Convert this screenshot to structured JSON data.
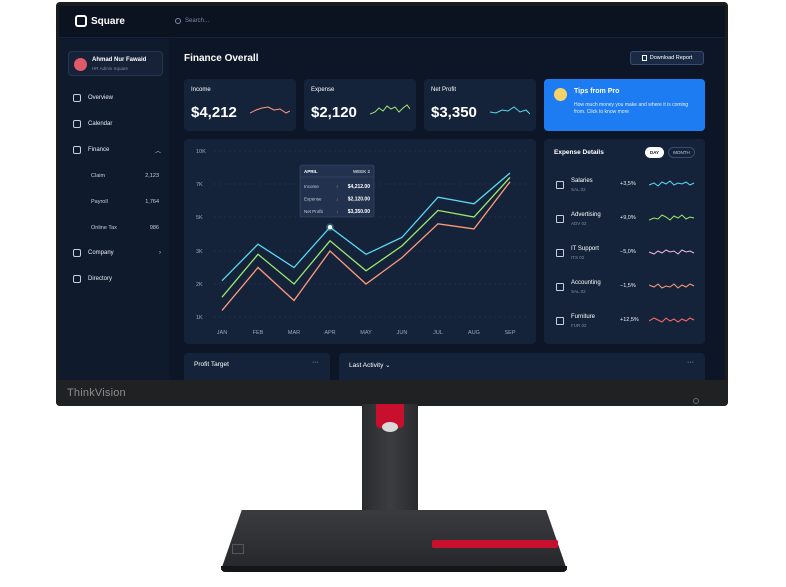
{
  "monitor": {
    "brand": "ThinkVision"
  },
  "app": {
    "name": "Square",
    "search_placeholder": "Search..."
  },
  "profile": {
    "name": "Ahmad Nur Fawaid",
    "role": "HR Admin Square"
  },
  "nav": {
    "overview": "Overview",
    "calendar": "Calendar",
    "finance": "Finance",
    "claim": {
      "label": "Claim",
      "count": "2,123"
    },
    "payroll": {
      "label": "Payroll",
      "count": "1,764"
    },
    "online_tax": {
      "label": "Online Tax",
      "count": "986"
    },
    "company": "Company",
    "directory": "Directory"
  },
  "main": {
    "title": "Finance Overall",
    "download_label": "Download Report"
  },
  "cards": [
    {
      "label": "Income",
      "value": "$4,212",
      "color": "#ff9b7a"
    },
    {
      "label": "Expense",
      "value": "$2,120",
      "color": "#9be870"
    },
    {
      "label": "Net Profit",
      "value": "$3,350",
      "color": "#5ad8f0"
    }
  ],
  "tips": {
    "title": "Tips from Pro",
    "text": "How much money you make and where it is coming from. Click to know more"
  },
  "chart_data": {
    "type": "line",
    "categories": [
      "JAN",
      "FEB",
      "MAR",
      "APR",
      "MAY",
      "JUN",
      "JUL",
      "AUG",
      "SEP"
    ],
    "y_ticks": [
      "10K",
      "7K",
      "5K",
      "3K",
      "2K",
      "1K"
    ],
    "series": [
      {
        "name": "Income",
        "color": "#5ad8f0",
        "values": [
          2100,
          3400,
          2500,
          4400,
          2900,
          3800,
          6200,
          5800,
          8000
        ]
      },
      {
        "name": "Expense",
        "color": "#9be870",
        "values": [
          1600,
          2900,
          2000,
          3600,
          2400,
          3300,
          5400,
          5000,
          7600
        ]
      },
      {
        "name": "Net Profit",
        "color": "#ff9b7a",
        "values": [
          1200,
          2500,
          1500,
          3000,
          2000,
          2800,
          4600,
          4300,
          7200
        ]
      }
    ],
    "tooltip": {
      "month": "APRIL",
      "week": "WEEK 2",
      "rows": [
        {
          "label": "Income",
          "value": "$4,212.00"
        },
        {
          "label": "Expense",
          "value": "$2,120.00"
        },
        {
          "label": "Net Profit",
          "value": "$3,350.00"
        }
      ]
    }
  },
  "expense_details": {
    "title": "Expense Details",
    "toggle_day": "DAY",
    "toggle_month": "MONTH",
    "rows": [
      {
        "name": "Salaries",
        "code": "SAL 02",
        "pct": "+3,5%",
        "color": "#5ad8f0"
      },
      {
        "name": "Advertising",
        "code": "ADV 02",
        "pct": "+9,0%",
        "color": "#9be870"
      },
      {
        "name": "IT Support",
        "code": "ITS 02",
        "pct": "−5,0%",
        "color": "#f2b8e0"
      },
      {
        "name": "Accounting",
        "code": "SAL 02",
        "pct": "−1,5%",
        "color": "#ff9b7a"
      },
      {
        "name": "Furniture",
        "code": "FUR 02",
        "pct": "+12,5%",
        "color": "#ff6b6b"
      }
    ]
  },
  "bottom": {
    "profit_target": "Profit Target",
    "last_activity": "Last Activity"
  }
}
